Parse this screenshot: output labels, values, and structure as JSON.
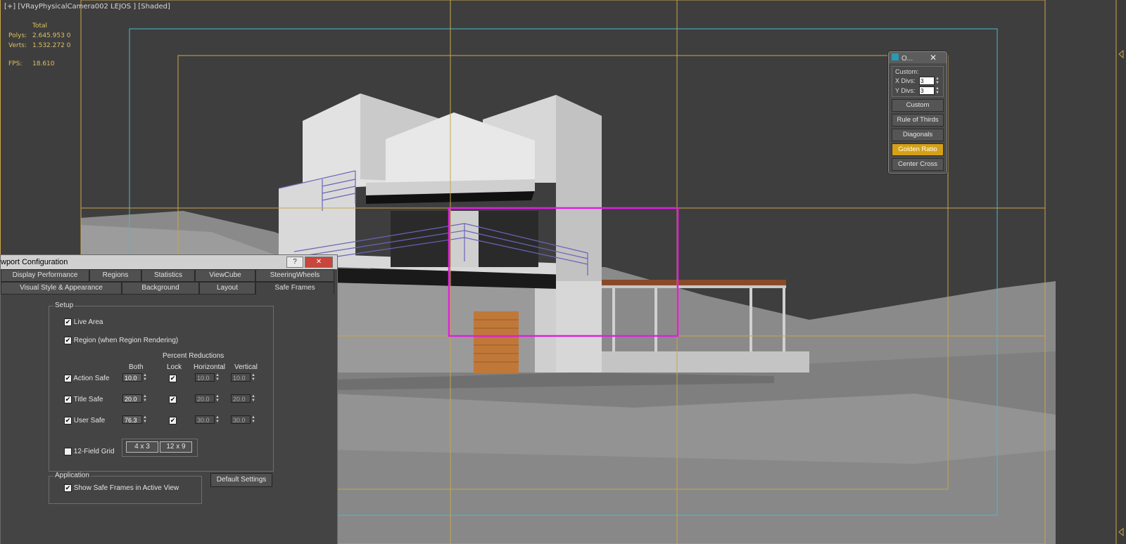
{
  "viewport": {
    "label": "[+] [VRayPhysicalCamera002 LEJOS ] [Shaded]",
    "stats": {
      "header": "Total",
      "polys_label": "Polys:",
      "polys_value": "2.645.953",
      "polys_sel": "0",
      "verts_label": "Verts:",
      "verts_value": "1.532.272",
      "verts_sel": "0",
      "fps_label": "FPS:",
      "fps_value": "18.610"
    }
  },
  "overlay_panel": {
    "title": "O...",
    "close": "✕",
    "custom_label": "Custom:",
    "xdivs_label": "X Divs:",
    "xdivs_value": "3",
    "ydivs_label": "Y Divs:",
    "ydivs_value": "3",
    "buttons": [
      "Custom",
      "Rule of Thirds",
      "Diagonals",
      "Golden Ratio",
      "Center Cross"
    ],
    "active": "Golden Ratio",
    "accent": "#d4a017"
  },
  "dialog": {
    "title": "wport Configuration",
    "help": "?",
    "close": "✕",
    "tabs_row1": [
      "Display Performance",
      "Regions",
      "Statistics",
      "ViewCube",
      "SteeringWheels"
    ],
    "tabs_row2": [
      "Visual Style & Appearance",
      "Background",
      "Layout",
      "Safe Frames"
    ],
    "selected_tab": "Safe Frames",
    "setup": {
      "caption": "Setup",
      "live_area": "Live Area",
      "region": "Region (when Region Rendering)",
      "percent_reductions": "Percent Reductions",
      "col_both": "Both",
      "col_lock": "Lock",
      "col_horizontal": "Horizontal",
      "col_vertical": "Vertical",
      "rows": [
        {
          "label": "Action Safe",
          "both": "10.0",
          "horizontal": "10.0",
          "vertical": "10.0"
        },
        {
          "label": "Title Safe",
          "both": "20.0",
          "horizontal": "20.0",
          "vertical": "20.0"
        },
        {
          "label": "User Safe",
          "both": "76.3",
          "horizontal": "30.0",
          "vertical": "30.0"
        }
      ],
      "grid_label": "12-Field Grid",
      "grid_4x3": "4 x 3",
      "grid_12x9": "12 x 9"
    },
    "application": {
      "caption": "Application",
      "show_safe": "Show Safe Frames in Active View"
    },
    "default_settings": "Default Settings",
    "check_mark": "✔"
  },
  "colors": {
    "safe_yellow": "#c8a64a",
    "safe_cyan": "#4fb8c8",
    "region_magenta": "#e020e0"
  }
}
